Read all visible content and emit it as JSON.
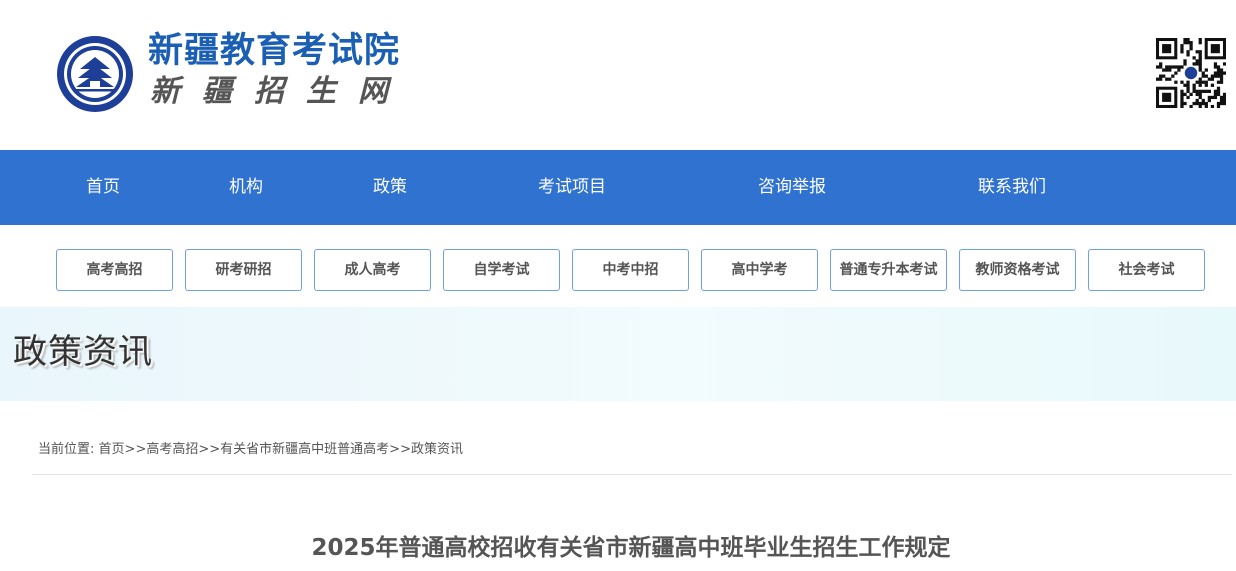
{
  "header": {
    "site_title": "新疆教育考试院",
    "site_subtitle": "新疆招生网",
    "emblem_icon": "exam-authority-emblem-icon",
    "qr_icon": "qr-code-icon"
  },
  "nav": {
    "items": [
      {
        "label": "首页"
      },
      {
        "label": "机构"
      },
      {
        "label": "政策"
      },
      {
        "label": "考试项目"
      },
      {
        "label": "咨询举报"
      },
      {
        "label": "联系我们"
      }
    ]
  },
  "subnav": {
    "items": [
      {
        "label": "高考高招"
      },
      {
        "label": "研考研招"
      },
      {
        "label": "成人高考"
      },
      {
        "label": "自学考试"
      },
      {
        "label": "中考中招"
      },
      {
        "label": "高中学考"
      },
      {
        "label": "普通专升本考试"
      },
      {
        "label": "教师资格考试"
      },
      {
        "label": "社会考试"
      }
    ]
  },
  "banner": {
    "title": "政策资讯"
  },
  "breadcrumb": {
    "prefix": "当前位置:",
    "items": [
      {
        "label": "首页"
      },
      {
        "label": "高考高招"
      },
      {
        "label": "有关省市新疆高中班普通高考"
      },
      {
        "label": "政策资讯"
      }
    ],
    "separator": ">>"
  },
  "article": {
    "title": "2025年普通高校招收有关省市新疆高中班毕业生招生工作规定"
  },
  "colors": {
    "brand_blue": "#1a5fb4",
    "nav_bg": "#2f72d0",
    "button_border": "#6fa0e6",
    "banner_bg": "#eef9fc"
  }
}
